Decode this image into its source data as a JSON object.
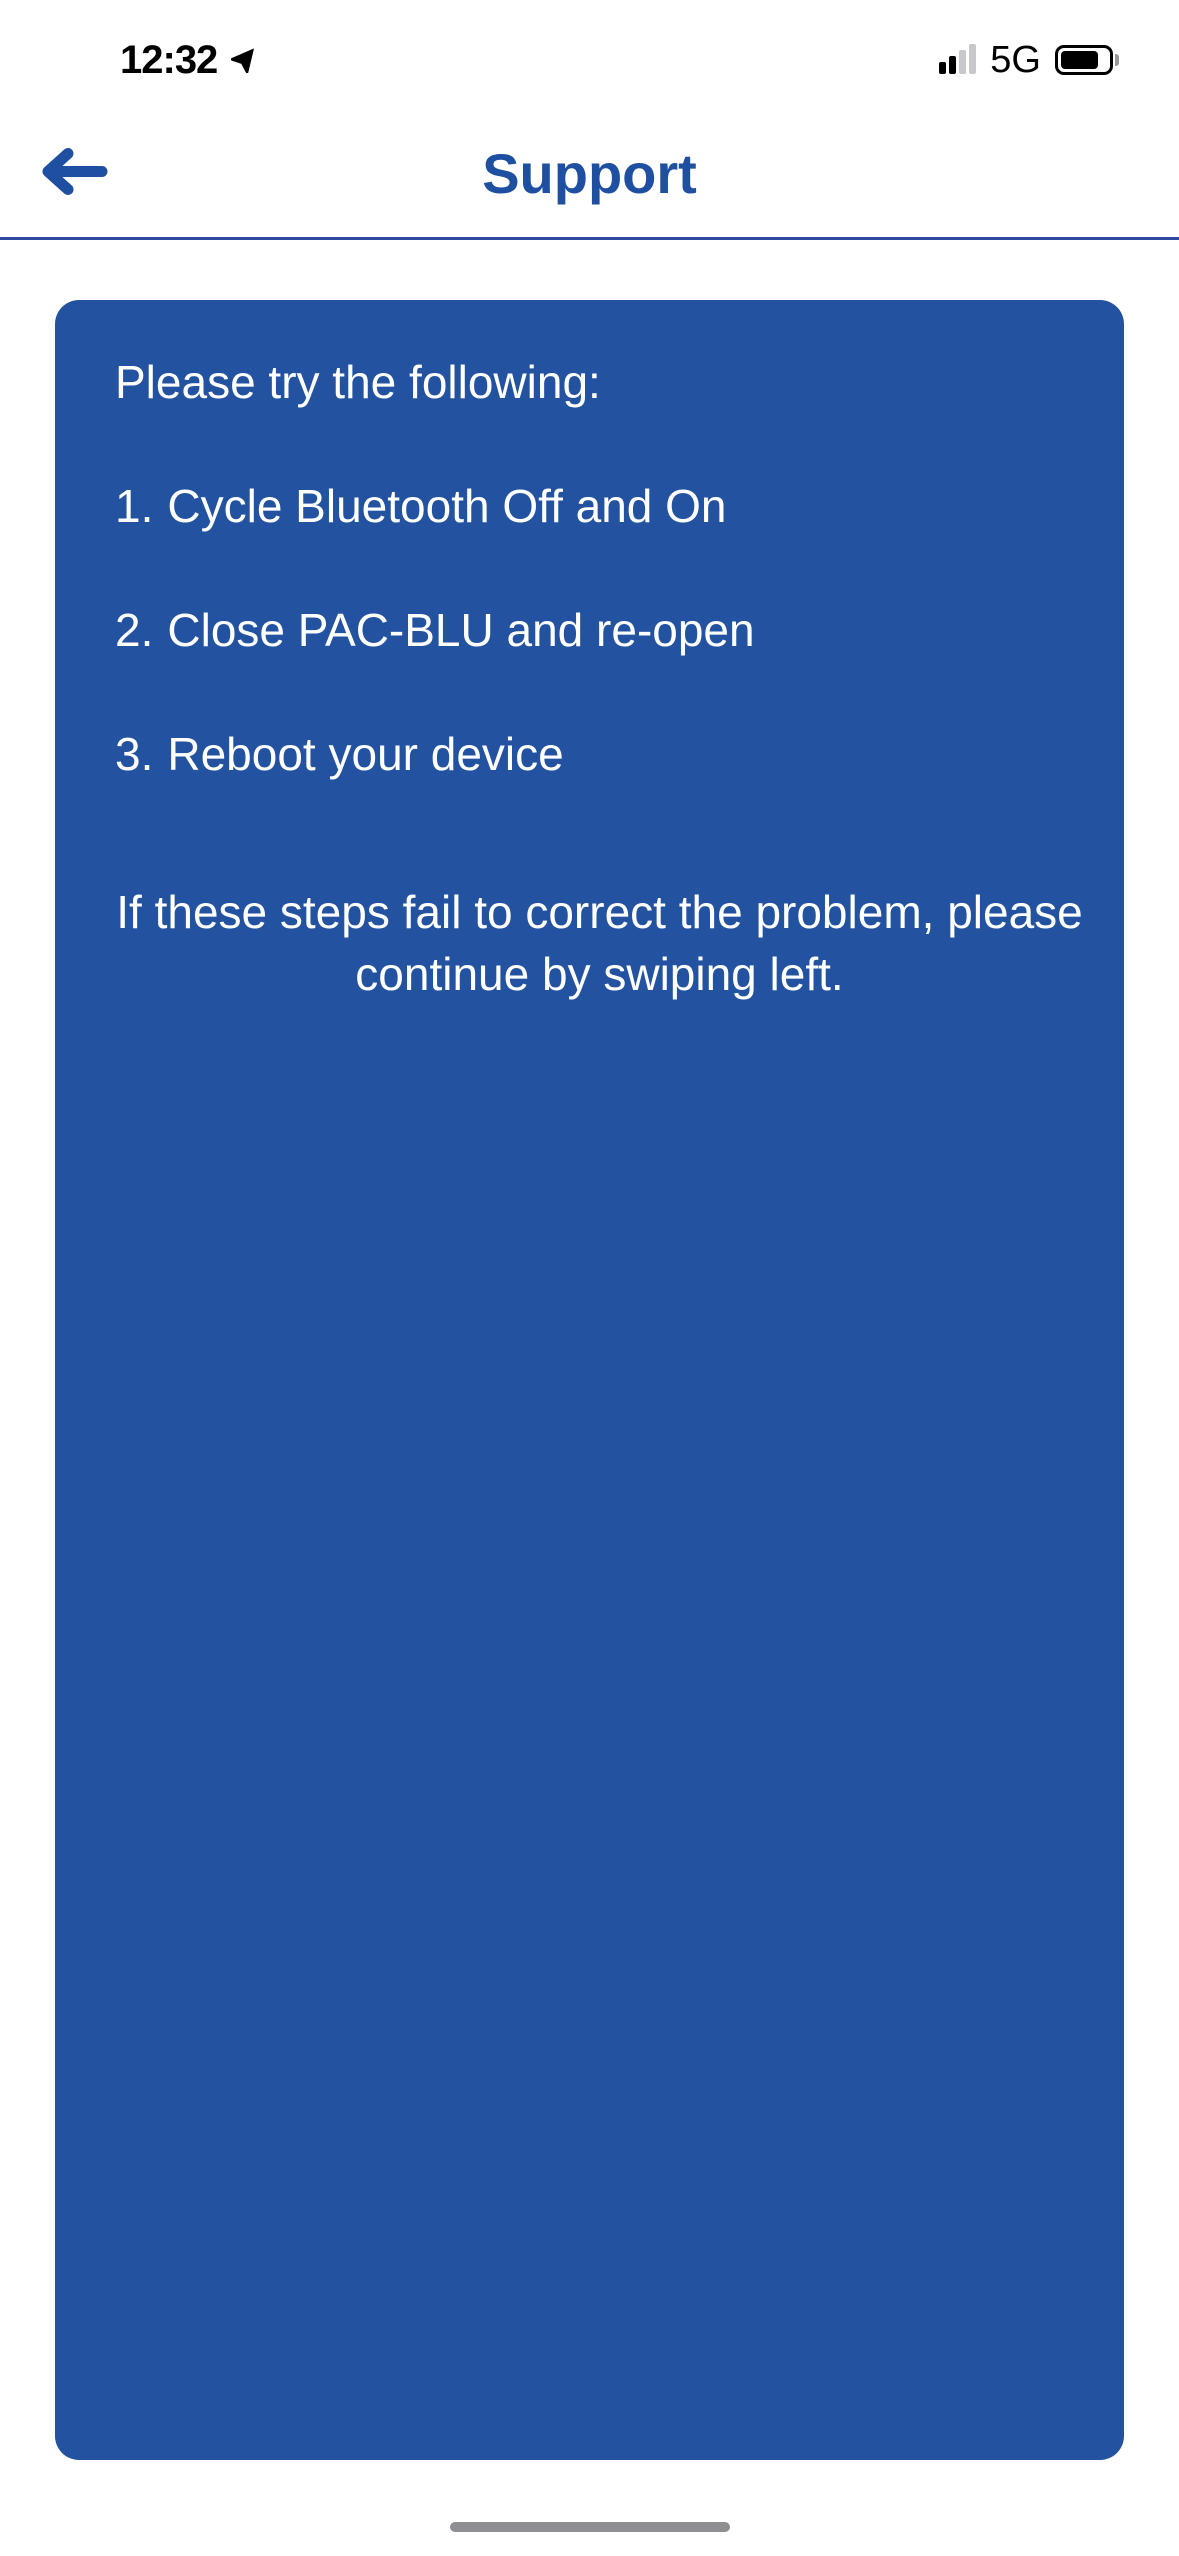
{
  "status_bar": {
    "time": "12:32",
    "network_type": "5G"
  },
  "header": {
    "title": "Support"
  },
  "card": {
    "intro": "Please try the following:",
    "steps": [
      {
        "num": "1.",
        "text": "Cycle Bluetooth Off and On"
      },
      {
        "num": "2.",
        "text": "Close PAC-BLU and re-open"
      },
      {
        "num": "3.",
        "text": "Reboot your device"
      }
    ],
    "footer": "If these steps fail to correct the problem, please continue by swiping left."
  }
}
